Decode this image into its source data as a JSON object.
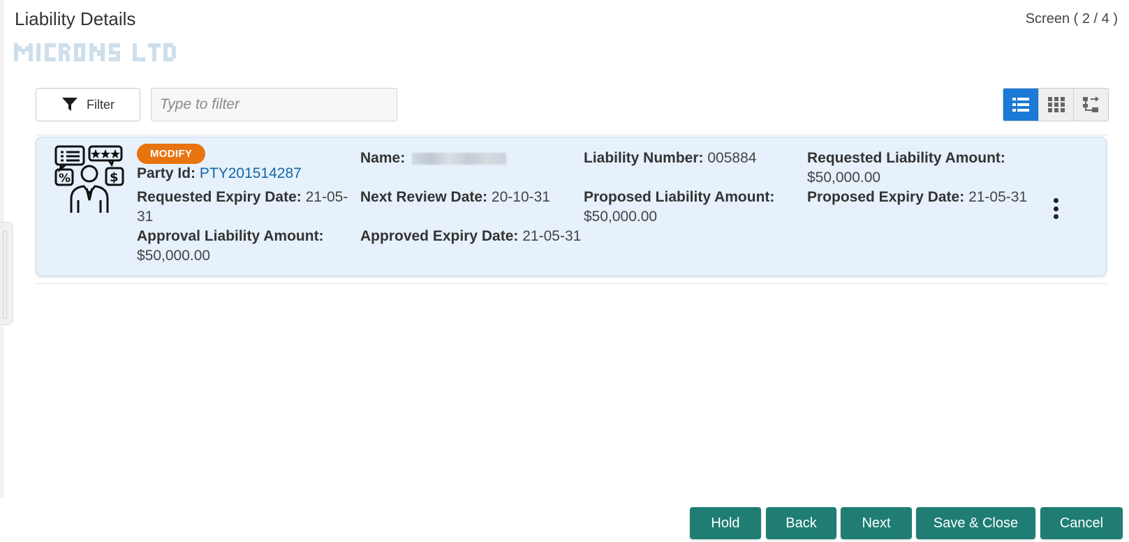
{
  "header": {
    "title": "Liability Details",
    "screen_indicator": "Screen ( 2 / 4 )",
    "company_name": "MICRONS LTD"
  },
  "toolbar": {
    "filter_label": "Filter",
    "filter_placeholder": "Type to filter",
    "view_options": [
      "list-view",
      "grid-view",
      "tree-view"
    ],
    "active_view": "list-view"
  },
  "card": {
    "badge": "MODIFY",
    "party_id_label": "Party Id:",
    "party_id": "PTY201514287",
    "name_label": "Name:",
    "liability_number_label": "Liability Number:",
    "liability_number": "005884",
    "requested_amount_label": "Requested Liability Amount:",
    "requested_amount": "$50,000.00",
    "requested_expiry_label": "Requested Expiry Date:",
    "requested_expiry_line1": "21-05-",
    "requested_expiry_line2": "31",
    "next_review_label": "Next Review Date:",
    "next_review": "20-10-31",
    "proposed_amount_label": "Proposed Liability Amount:",
    "proposed_amount": "$50,000.00",
    "proposed_expiry_label": "Proposed Expiry Date:",
    "proposed_expiry": "21-05-31",
    "approval_amount_label": "Approval Liability Amount:",
    "approval_amount": "$50,000.00",
    "approved_expiry_label": "Approved Expiry Date:",
    "approved_expiry": "21-05-31"
  },
  "footer": {
    "hold": "Hold",
    "back": "Back",
    "next": "Next",
    "save_close": "Save & Close",
    "cancel": "Cancel"
  },
  "colors": {
    "accent_blue": "#1a7ad6",
    "badge_orange": "#e8740f",
    "button_teal": "#1f7d74",
    "card_background": "#e6f1fb",
    "link_blue": "#1466a8"
  }
}
